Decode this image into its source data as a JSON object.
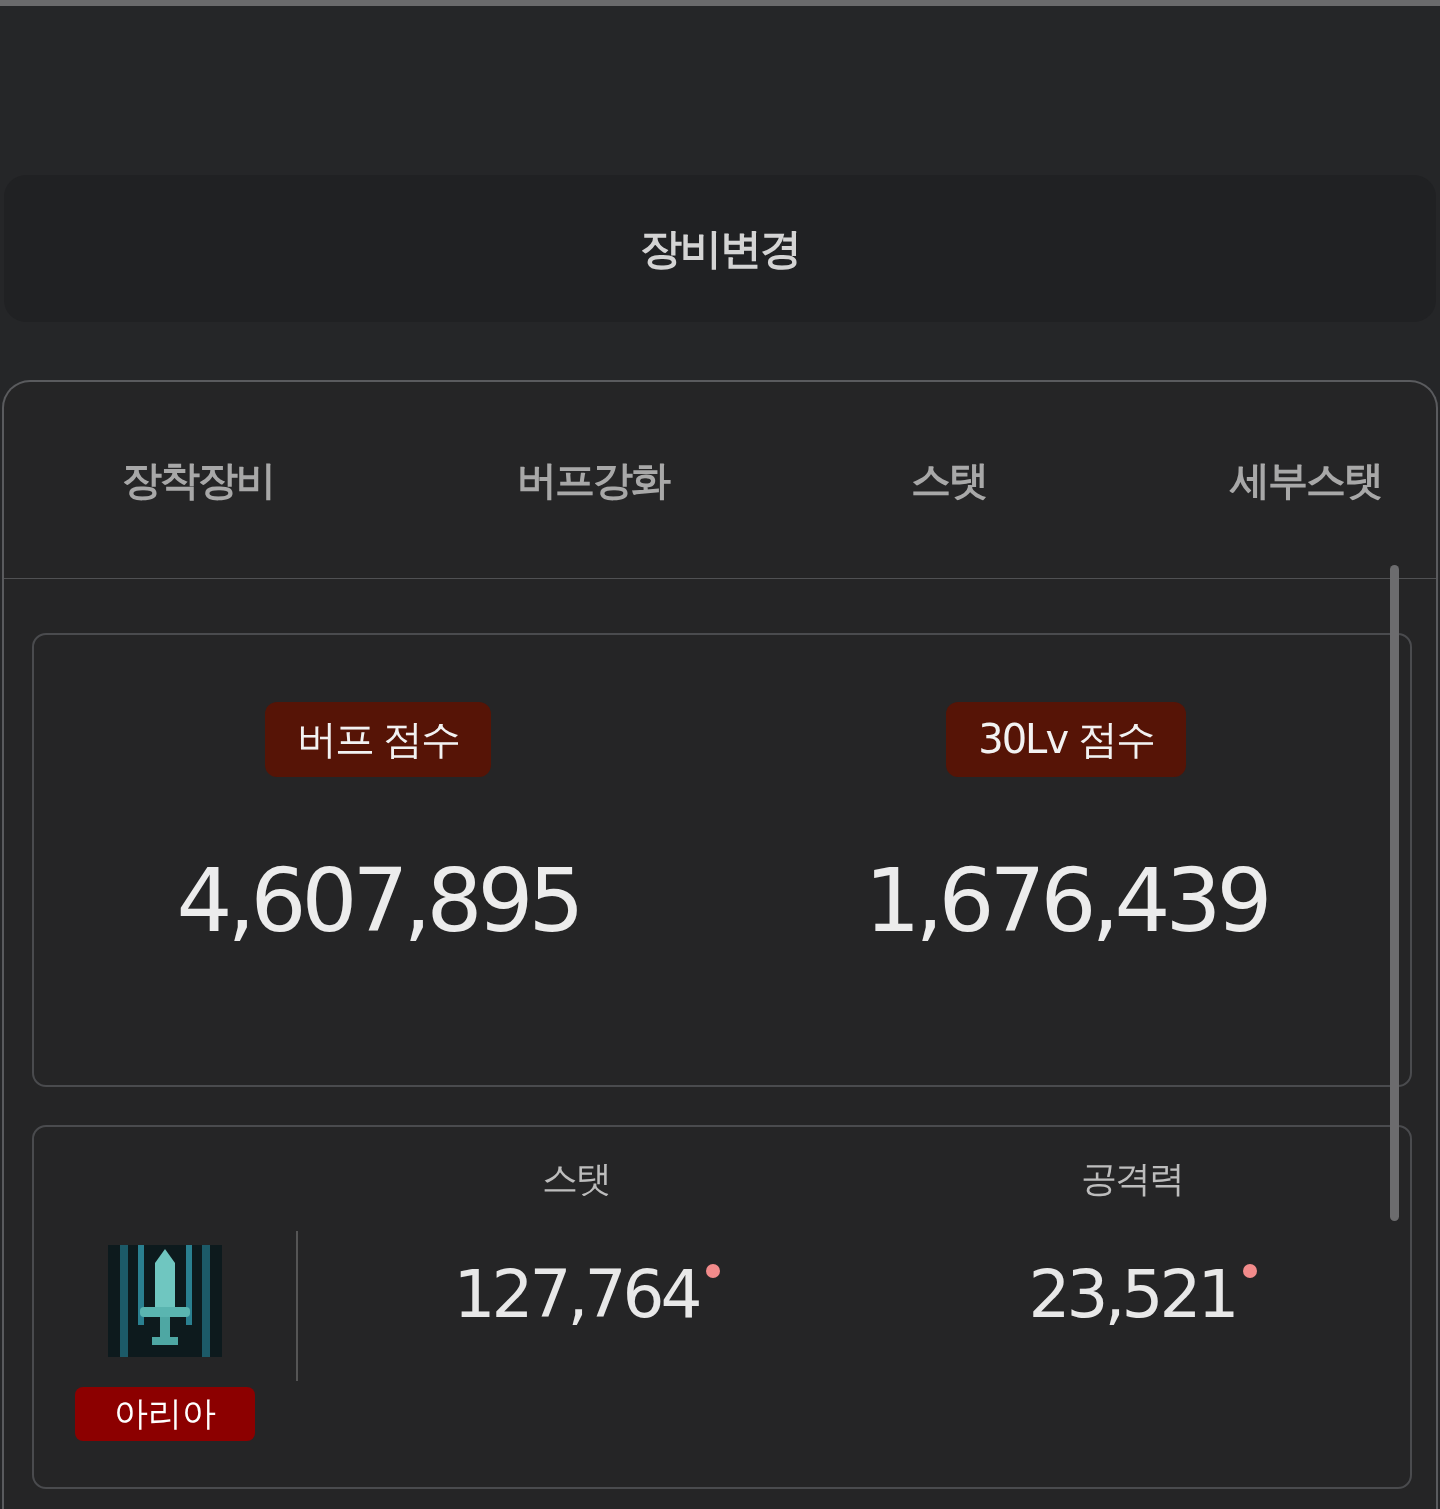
{
  "header": {
    "title": "장비변경"
  },
  "tabs": [
    {
      "label": "장착장비"
    },
    {
      "label": "버프강화"
    },
    {
      "label": "스탯"
    },
    {
      "label": "세부스탯"
    }
  ],
  "scores": [
    {
      "label": "버프 점수",
      "value": "4,607,895"
    },
    {
      "label": "30Lv 점수",
      "value": "1,676,439"
    }
  ],
  "item": {
    "name": "아리아"
  },
  "stats": [
    {
      "label": "스탯",
      "value": "127,764"
    },
    {
      "label": "공격력",
      "value": "23,521"
    }
  ]
}
